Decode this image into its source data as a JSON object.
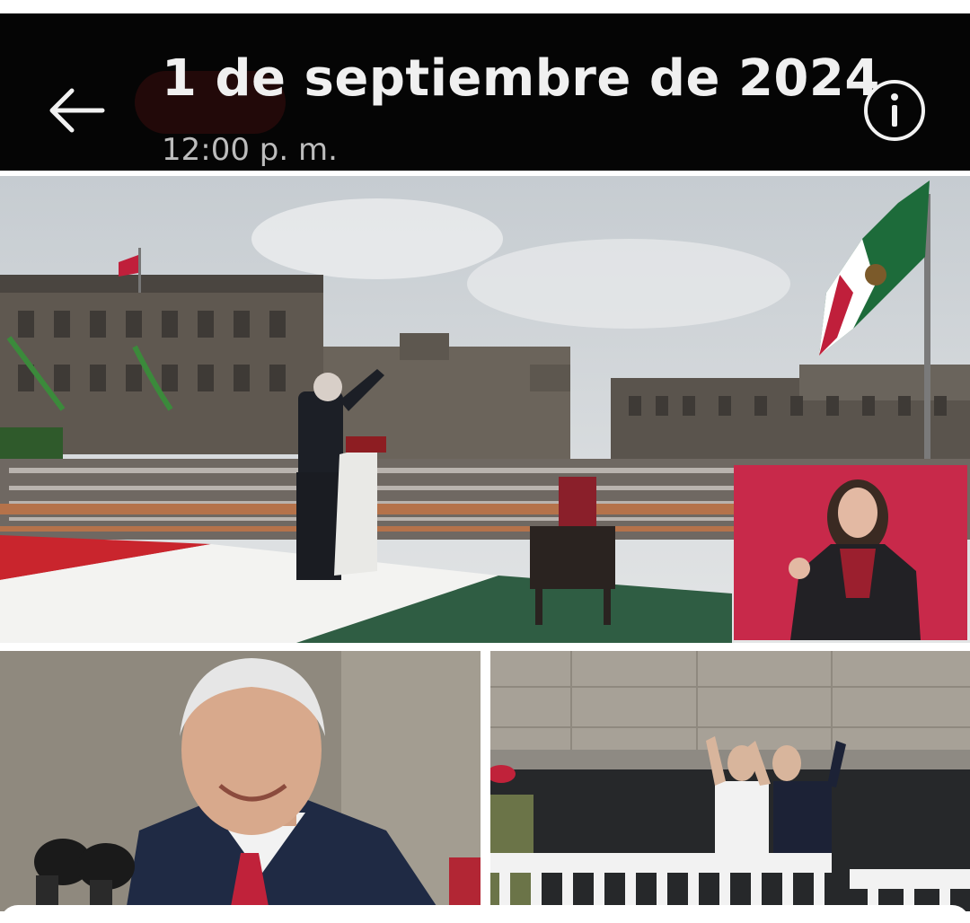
{
  "header": {
    "title": "1 de septiembre de 2024",
    "subtitle": "12:00 p. m.",
    "back_icon": "arrow-left-icon",
    "info_icon": "info-circle-icon"
  },
  "photos": {
    "main": "Tribune speech in the Zócalo with crowd and sign-language interpreter",
    "left": "Smiling man at microphones",
    "right": "Couple waving from a balcony"
  },
  "colors": {
    "header_bg": "#050505",
    "title": "#f0f0f0",
    "subtitle": "#bcbcbc",
    "accent_red": "#c01f3b",
    "flag_green": "#1d6b3a"
  }
}
